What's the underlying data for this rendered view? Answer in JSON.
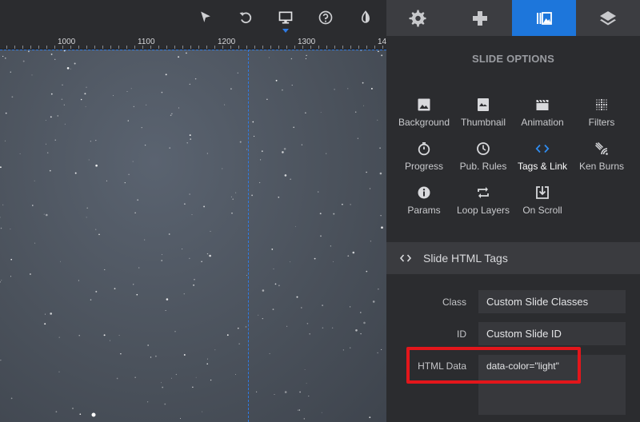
{
  "toolbar": {
    "tools": [
      {
        "name": "select-icon"
      },
      {
        "name": "undo-icon"
      },
      {
        "name": "desktop-icon"
      },
      {
        "name": "help-icon"
      },
      {
        "name": "contrast-icon"
      }
    ]
  },
  "ruler": {
    "labels": [
      "1000",
      "1100",
      "1200",
      "1300",
      "14"
    ]
  },
  "right_tabs": [
    {
      "name": "gear-icon",
      "active": false
    },
    {
      "name": "gamepad-icon",
      "active": false
    },
    {
      "name": "slides-icon",
      "active": true
    },
    {
      "name": "layers-icon",
      "active": false
    }
  ],
  "panel": {
    "title": "SLIDE OPTIONS",
    "options": [
      {
        "label": "Background",
        "icon": "image-icon"
      },
      {
        "label": "Thumbnail",
        "icon": "thumbnail-icon"
      },
      {
        "label": "Animation",
        "icon": "clapper-icon"
      },
      {
        "label": "Filters",
        "icon": "filters-icon"
      },
      {
        "label": "Progress",
        "icon": "stopwatch-icon"
      },
      {
        "label": "Pub. Rules",
        "icon": "clock-icon"
      },
      {
        "label": "Tags & Link",
        "icon": "code-icon",
        "active": true
      },
      {
        "label": "Ken Burns",
        "icon": "ken-burns-icon"
      },
      {
        "label": "Params",
        "icon": "info-icon"
      },
      {
        "label": "Loop Layers",
        "icon": "loop-icon"
      },
      {
        "label": "On Scroll",
        "icon": "on-scroll-icon"
      }
    ],
    "section_title": "Slide HTML Tags",
    "fields": {
      "class_label": "Class",
      "class_placeholder": "Custom Slide Classes",
      "id_label": "ID",
      "id_placeholder": "Custom Slide ID",
      "html_data_label": "HTML Data",
      "html_data_value": "data-color=\"light\""
    }
  },
  "colors": {
    "accent": "#1d76db",
    "guide": "#2f7be5",
    "highlight": "#e3161b"
  }
}
